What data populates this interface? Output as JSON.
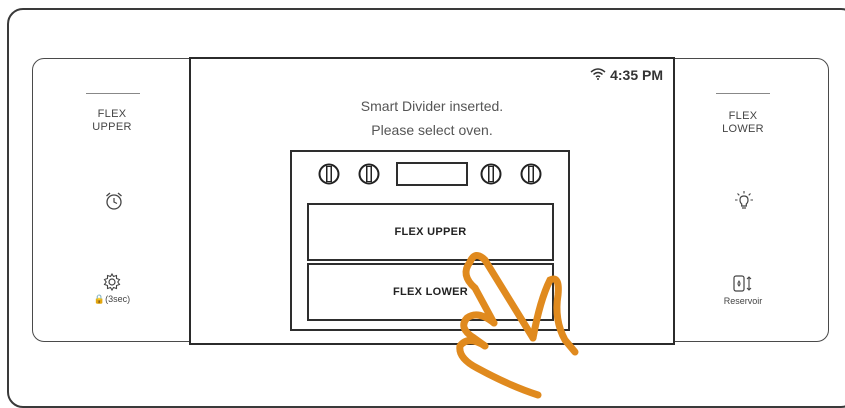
{
  "left_panel": {
    "title_line1": "FLEX",
    "title_line2": "UPPER",
    "timer_icon": "alarm-clock-icon",
    "settings_icon": "gear-icon",
    "settings_caption": "🔒(3sec)"
  },
  "right_panel": {
    "title_line1": "FLEX",
    "title_line2": "LOWER",
    "light_icon": "light-bulb-icon",
    "reservoir_icon": "reservoir-icon",
    "reservoir_label": "Reservoir"
  },
  "screen": {
    "time": "4:35 PM",
    "wifi_icon": "wifi-icon",
    "message_line1": "Smart Divider inserted.",
    "message_line2": "Please select oven.",
    "oven": {
      "upper_label": "FLEX UPPER",
      "lower_label": "FLEX LOWER"
    }
  },
  "colors": {
    "hand_stroke": "#e08a1e",
    "outline": "#2e2e2e"
  }
}
